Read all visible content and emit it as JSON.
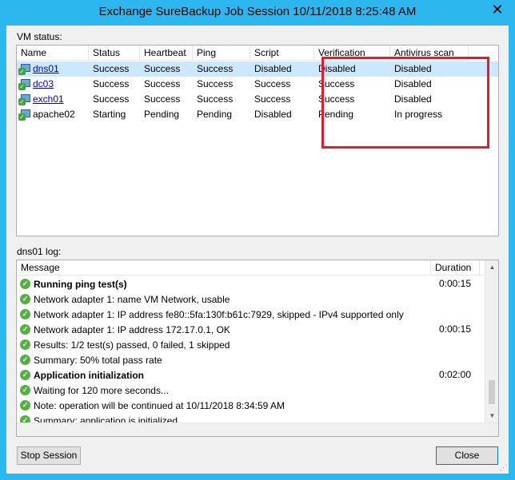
{
  "window": {
    "title": "Exchange SureBackup Job Session 10/11/2018 8:25:48 AM",
    "close_glyph": "✕"
  },
  "vm_status": {
    "label": "VM status:",
    "columns": [
      "Name",
      "Status",
      "Heartbeat",
      "Ping",
      "Script",
      "Verification",
      "Antivirus scan"
    ],
    "rows": [
      {
        "name": "dns01",
        "link": true,
        "status": "Success",
        "heartbeat": "Success",
        "ping": "Success",
        "script": "Disabled",
        "verification": "Disabled",
        "antivirus": "Disabled"
      },
      {
        "name": "dc03",
        "link": true,
        "status": "Success",
        "heartbeat": "Success",
        "ping": "Success",
        "script": "Success",
        "verification": "Success",
        "antivirus": "Disabled"
      },
      {
        "name": "exch01",
        "link": true,
        "status": "Success",
        "heartbeat": "Success",
        "ping": "Success",
        "script": "Success",
        "verification": "Success",
        "antivirus": "Disabled"
      },
      {
        "name": "apache02",
        "link": false,
        "status": "Starting",
        "heartbeat": "Pending",
        "ping": "Pending",
        "script": "Disabled",
        "verification": "Pending",
        "antivirus": "In progress"
      }
    ],
    "highlight_color": "#e8192c"
  },
  "log": {
    "label": "dns01 log:",
    "columns": [
      "Message",
      "Duration"
    ],
    "rows": [
      {
        "message": "Running ping test(s)",
        "bold": true,
        "duration": "0:00:15"
      },
      {
        "message": "Network adapter 1: name VM Network, usable",
        "bold": false,
        "duration": ""
      },
      {
        "message": "Network adapter 1: IP address fe80::5fa:130f:b61c:7929, skipped - IPv4 supported only",
        "bold": false,
        "duration": ""
      },
      {
        "message": "Network adapter 1: IP address 172.17.0.1, OK",
        "bold": false,
        "duration": "0:00:15"
      },
      {
        "message": "Results: 1/2 test(s) passed, 0 failed, 1 skipped",
        "bold": false,
        "duration": ""
      },
      {
        "message": "Summary: 50% total pass rate",
        "bold": false,
        "duration": ""
      },
      {
        "message": "Application initialization",
        "bold": true,
        "duration": "0:02:00"
      },
      {
        "message": "Waiting for 120 more seconds...",
        "bold": false,
        "duration": ""
      },
      {
        "message": "Note: operation will be continued at 10/11/2018 8:34:59 AM",
        "bold": false,
        "duration": ""
      },
      {
        "message": "Summary: application is initialized",
        "bold": false,
        "duration": ""
      }
    ],
    "status_icon": "check-circle-icon"
  },
  "buttons": {
    "stop_session": "Stop Session",
    "close": "Close"
  }
}
